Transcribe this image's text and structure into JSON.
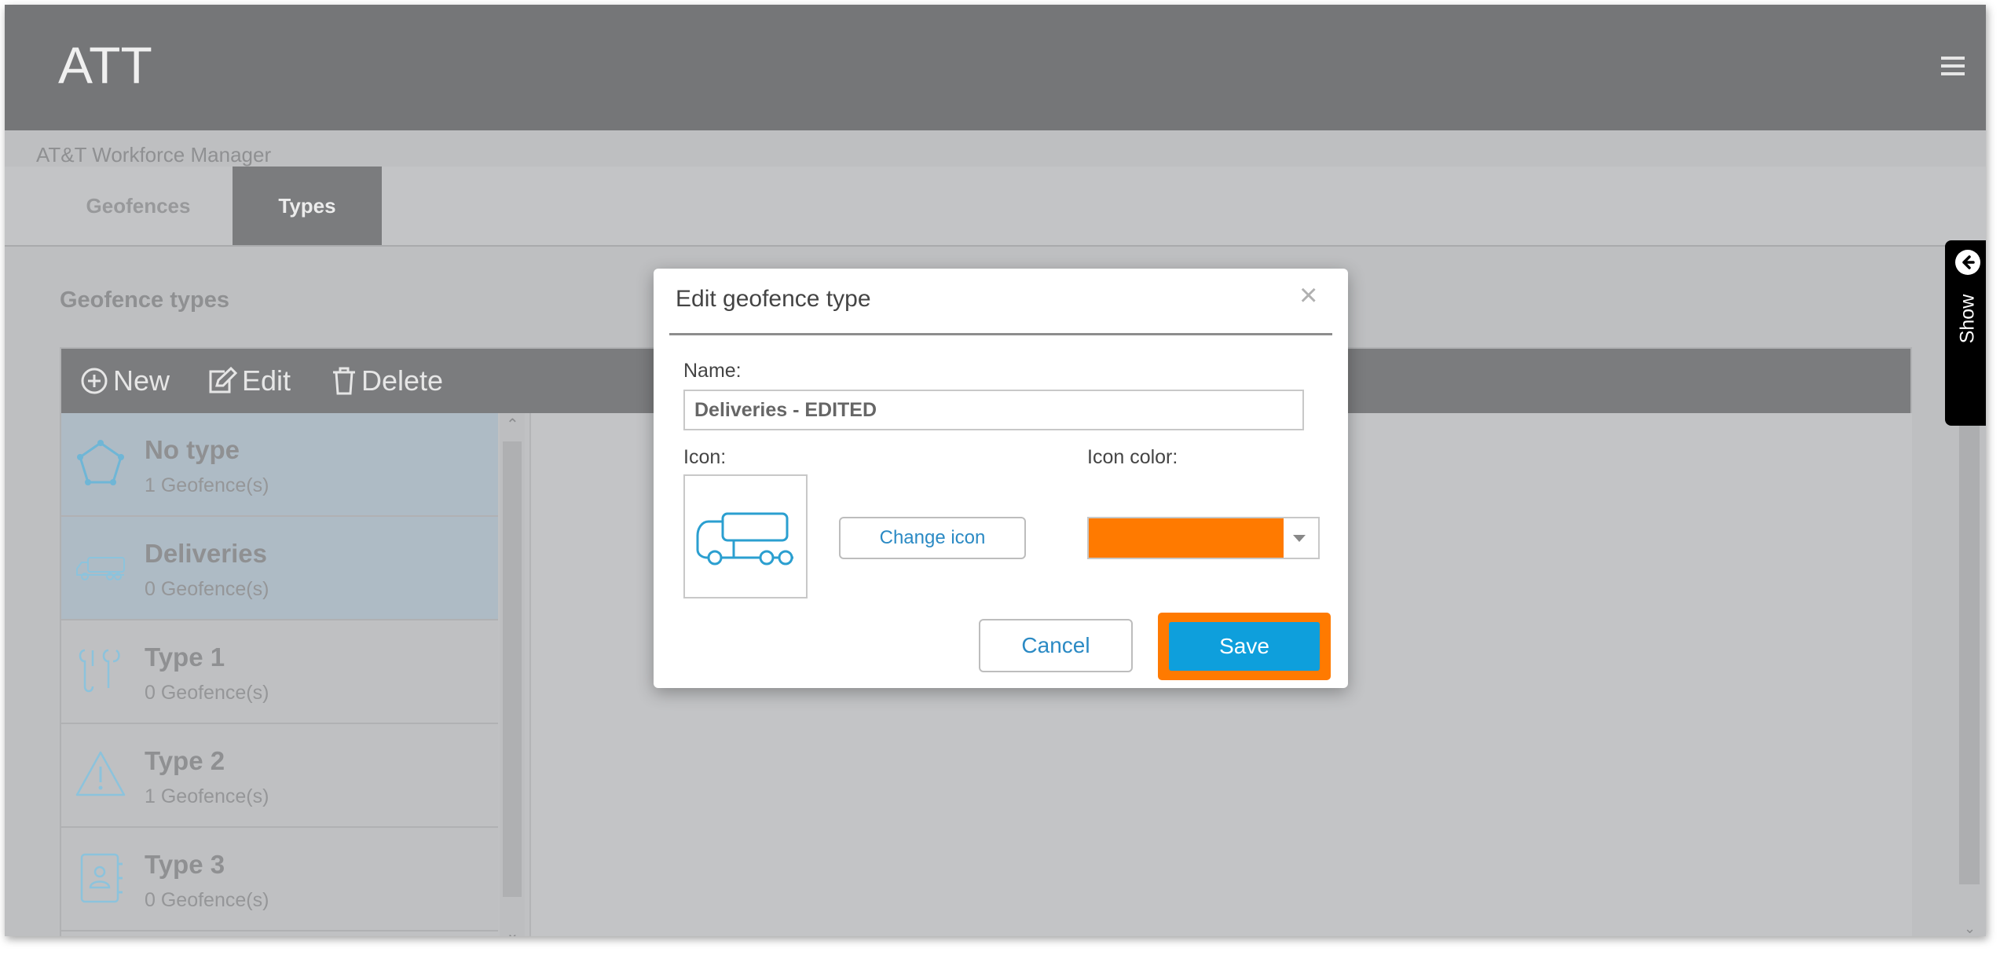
{
  "header": {
    "title": "ATT",
    "menu_icon": "hamburger-icon"
  },
  "subtitle": "AT&T Workforce Manager",
  "tabs": [
    {
      "label": "Geofences",
      "active": false
    },
    {
      "label": "Types",
      "active": true
    }
  ],
  "section_title": "Geofence types",
  "toolbar": {
    "new_label": "New",
    "edit_label": "Edit",
    "delete_label": "Delete"
  },
  "types": [
    {
      "name": "No type",
      "count": "1 Geofence(s)",
      "icon": "pentagon-icon",
      "selected": true
    },
    {
      "name": "Deliveries",
      "count": "0 Geofence(s)",
      "icon": "truck-icon",
      "selected": true
    },
    {
      "name": "Type 1",
      "count": "0 Geofence(s)",
      "icon": "hooks-icon",
      "selected": false
    },
    {
      "name": "Type 2",
      "count": "1 Geofence(s)",
      "icon": "warning-icon",
      "selected": false
    },
    {
      "name": "Type 3",
      "count": "0 Geofence(s)",
      "icon": "contact-book-icon",
      "selected": false
    }
  ],
  "side_panel": {
    "label": "Show",
    "icon": "arrow-left-circle-icon"
  },
  "modal": {
    "title": "Edit geofence type",
    "name_label": "Name:",
    "name_value": "Deliveries - EDITED",
    "icon_label": "Icon:",
    "icon": "truck-icon",
    "change_icon_label": "Change icon",
    "icon_color_label": "Icon color:",
    "icon_color": "#ff7a00",
    "cancel_label": "Cancel",
    "save_label": "Save"
  },
  "colors": {
    "accent": "#0e9fdc",
    "highlight": "#ff7a00",
    "icon_stroke": "#2b9fd0"
  }
}
